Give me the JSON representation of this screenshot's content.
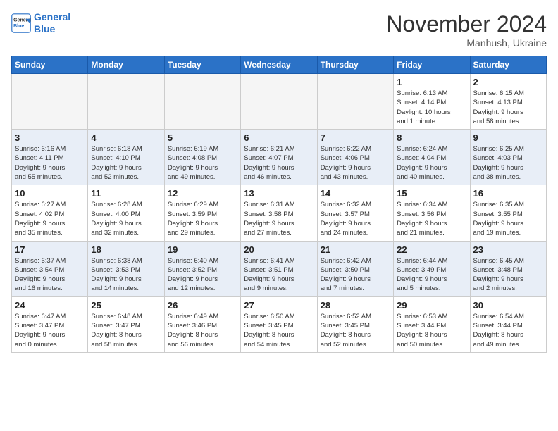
{
  "header": {
    "logo_line1": "General",
    "logo_line2": "Blue",
    "month_title": "November 2024",
    "location": "Manhush, Ukraine"
  },
  "weekdays": [
    "Sunday",
    "Monday",
    "Tuesday",
    "Wednesday",
    "Thursday",
    "Friday",
    "Saturday"
  ],
  "weeks": [
    [
      {
        "day": "",
        "info": ""
      },
      {
        "day": "",
        "info": ""
      },
      {
        "day": "",
        "info": ""
      },
      {
        "day": "",
        "info": ""
      },
      {
        "day": "",
        "info": ""
      },
      {
        "day": "1",
        "info": "Sunrise: 6:13 AM\nSunset: 4:14 PM\nDaylight: 10 hours\nand 1 minute."
      },
      {
        "day": "2",
        "info": "Sunrise: 6:15 AM\nSunset: 4:13 PM\nDaylight: 9 hours\nand 58 minutes."
      }
    ],
    [
      {
        "day": "3",
        "info": "Sunrise: 6:16 AM\nSunset: 4:11 PM\nDaylight: 9 hours\nand 55 minutes."
      },
      {
        "day": "4",
        "info": "Sunrise: 6:18 AM\nSunset: 4:10 PM\nDaylight: 9 hours\nand 52 minutes."
      },
      {
        "day": "5",
        "info": "Sunrise: 6:19 AM\nSunset: 4:08 PM\nDaylight: 9 hours\nand 49 minutes."
      },
      {
        "day": "6",
        "info": "Sunrise: 6:21 AM\nSunset: 4:07 PM\nDaylight: 9 hours\nand 46 minutes."
      },
      {
        "day": "7",
        "info": "Sunrise: 6:22 AM\nSunset: 4:06 PM\nDaylight: 9 hours\nand 43 minutes."
      },
      {
        "day": "8",
        "info": "Sunrise: 6:24 AM\nSunset: 4:04 PM\nDaylight: 9 hours\nand 40 minutes."
      },
      {
        "day": "9",
        "info": "Sunrise: 6:25 AM\nSunset: 4:03 PM\nDaylight: 9 hours\nand 38 minutes."
      }
    ],
    [
      {
        "day": "10",
        "info": "Sunrise: 6:27 AM\nSunset: 4:02 PM\nDaylight: 9 hours\nand 35 minutes."
      },
      {
        "day": "11",
        "info": "Sunrise: 6:28 AM\nSunset: 4:00 PM\nDaylight: 9 hours\nand 32 minutes."
      },
      {
        "day": "12",
        "info": "Sunrise: 6:29 AM\nSunset: 3:59 PM\nDaylight: 9 hours\nand 29 minutes."
      },
      {
        "day": "13",
        "info": "Sunrise: 6:31 AM\nSunset: 3:58 PM\nDaylight: 9 hours\nand 27 minutes."
      },
      {
        "day": "14",
        "info": "Sunrise: 6:32 AM\nSunset: 3:57 PM\nDaylight: 9 hours\nand 24 minutes."
      },
      {
        "day": "15",
        "info": "Sunrise: 6:34 AM\nSunset: 3:56 PM\nDaylight: 9 hours\nand 21 minutes."
      },
      {
        "day": "16",
        "info": "Sunrise: 6:35 AM\nSunset: 3:55 PM\nDaylight: 9 hours\nand 19 minutes."
      }
    ],
    [
      {
        "day": "17",
        "info": "Sunrise: 6:37 AM\nSunset: 3:54 PM\nDaylight: 9 hours\nand 16 minutes."
      },
      {
        "day": "18",
        "info": "Sunrise: 6:38 AM\nSunset: 3:53 PM\nDaylight: 9 hours\nand 14 minutes."
      },
      {
        "day": "19",
        "info": "Sunrise: 6:40 AM\nSunset: 3:52 PM\nDaylight: 9 hours\nand 12 minutes."
      },
      {
        "day": "20",
        "info": "Sunrise: 6:41 AM\nSunset: 3:51 PM\nDaylight: 9 hours\nand 9 minutes."
      },
      {
        "day": "21",
        "info": "Sunrise: 6:42 AM\nSunset: 3:50 PM\nDaylight: 9 hours\nand 7 minutes."
      },
      {
        "day": "22",
        "info": "Sunrise: 6:44 AM\nSunset: 3:49 PM\nDaylight: 9 hours\nand 5 minutes."
      },
      {
        "day": "23",
        "info": "Sunrise: 6:45 AM\nSunset: 3:48 PM\nDaylight: 9 hours\nand 2 minutes."
      }
    ],
    [
      {
        "day": "24",
        "info": "Sunrise: 6:47 AM\nSunset: 3:47 PM\nDaylight: 9 hours\nand 0 minutes."
      },
      {
        "day": "25",
        "info": "Sunrise: 6:48 AM\nSunset: 3:47 PM\nDaylight: 8 hours\nand 58 minutes."
      },
      {
        "day": "26",
        "info": "Sunrise: 6:49 AM\nSunset: 3:46 PM\nDaylight: 8 hours\nand 56 minutes."
      },
      {
        "day": "27",
        "info": "Sunrise: 6:50 AM\nSunset: 3:45 PM\nDaylight: 8 hours\nand 54 minutes."
      },
      {
        "day": "28",
        "info": "Sunrise: 6:52 AM\nSunset: 3:45 PM\nDaylight: 8 hours\nand 52 minutes."
      },
      {
        "day": "29",
        "info": "Sunrise: 6:53 AM\nSunset: 3:44 PM\nDaylight: 8 hours\nand 50 minutes."
      },
      {
        "day": "30",
        "info": "Sunrise: 6:54 AM\nSunset: 3:44 PM\nDaylight: 8 hours\nand 49 minutes."
      }
    ]
  ]
}
